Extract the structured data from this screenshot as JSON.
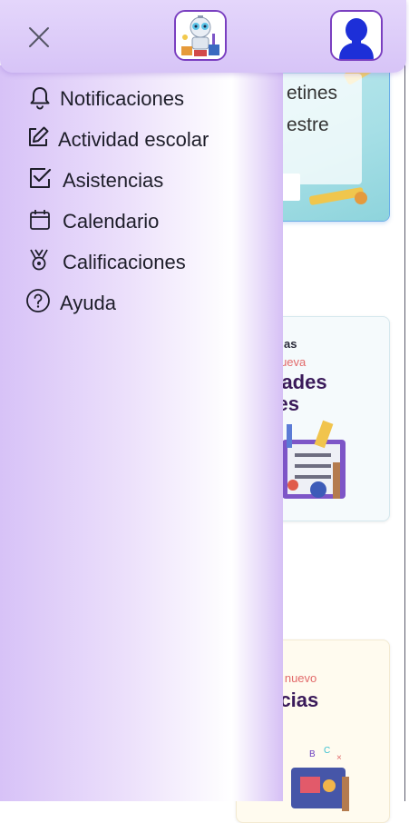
{
  "header": {
    "close_icon": "close-icon",
    "logo_icon": "robot-mascot-logo",
    "user_icon": "user-avatar-silhouette"
  },
  "drawer": {
    "items": [
      {
        "label": "Notificaciones",
        "icon": "bell-icon"
      },
      {
        "label": "Actividad escolar",
        "icon": "edit-icon"
      },
      {
        "label": "Asistencias",
        "icon": "checkbox-icon"
      },
      {
        "label": "Calendario",
        "icon": "calendar-icon"
      },
      {
        "label": "Calificaciones",
        "icon": "medal-icon"
      },
      {
        "label": "Ayuda",
        "icon": "help-icon"
      }
    ]
  },
  "background_cards": [
    {
      "lines": [
        "etines",
        "estre"
      ]
    },
    {
      "kicker": "as",
      "subtitle": "d nueva",
      "title_lines": [
        "dades",
        "res"
      ]
    },
    {
      "subtitle": "e nuevo",
      "title_lines": [
        "ncias"
      ]
    }
  ],
  "colors": {
    "header_bg": "#dccbf8",
    "accent_border": "#7a3fc0",
    "drawer_edge": "#d6c0f5",
    "subtitle_red": "#e26a6a",
    "title_purple": "#3a1a5a"
  }
}
